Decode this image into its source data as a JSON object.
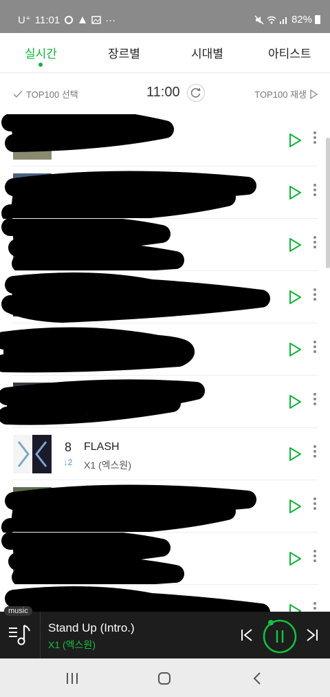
{
  "status_bar": {
    "carrier": "U⁺",
    "time": "11:01",
    "more": "···",
    "battery": "82%"
  },
  "tabs": [
    {
      "label": "실시간",
      "active": true
    },
    {
      "label": "장르별",
      "active": false
    },
    {
      "label": "시대별",
      "active": false
    },
    {
      "label": "아티스트",
      "active": false
    }
  ],
  "top_row": {
    "select_label": "TOP100 선택",
    "time": "11:00",
    "play_all_label": "TOP100 재생"
  },
  "chart_list": [
    {
      "rank": "",
      "change": "",
      "title": "",
      "artist": "",
      "redacted": true
    },
    {
      "rank": "",
      "change": "",
      "title": "",
      "artist": "",
      "redacted": true
    },
    {
      "rank": "",
      "change": "",
      "title": "",
      "artist": "",
      "redacted": true
    },
    {
      "rank": "",
      "change": "",
      "title": "",
      "artist": "",
      "redacted": true
    },
    {
      "rank": "",
      "change": "",
      "title": "",
      "artist": "",
      "redacted": true
    },
    {
      "rank": "",
      "change": "",
      "title": "",
      "artist": "",
      "redacted": true
    },
    {
      "rank": "8",
      "change": "↓2",
      "title": "FLASH",
      "artist": "X1 (엑스원)",
      "redacted": false
    },
    {
      "rank": "",
      "change": "",
      "title": "",
      "artist": "",
      "redacted": true
    },
    {
      "rank": "",
      "change": "",
      "title": "",
      "artist": "",
      "redacted": true
    },
    {
      "rank": "",
      "change": "",
      "title": "",
      "artist": "",
      "redacted": true
    }
  ],
  "player": {
    "badge": "music",
    "title": "Stand Up (Intro.)",
    "artist": "X1 (엑스원)"
  },
  "colors": {
    "accent": "#12b13a",
    "status_bar": "#8a8a8a",
    "player_bg": "#1d1d1d",
    "down_arrow": "#4a90d9"
  }
}
